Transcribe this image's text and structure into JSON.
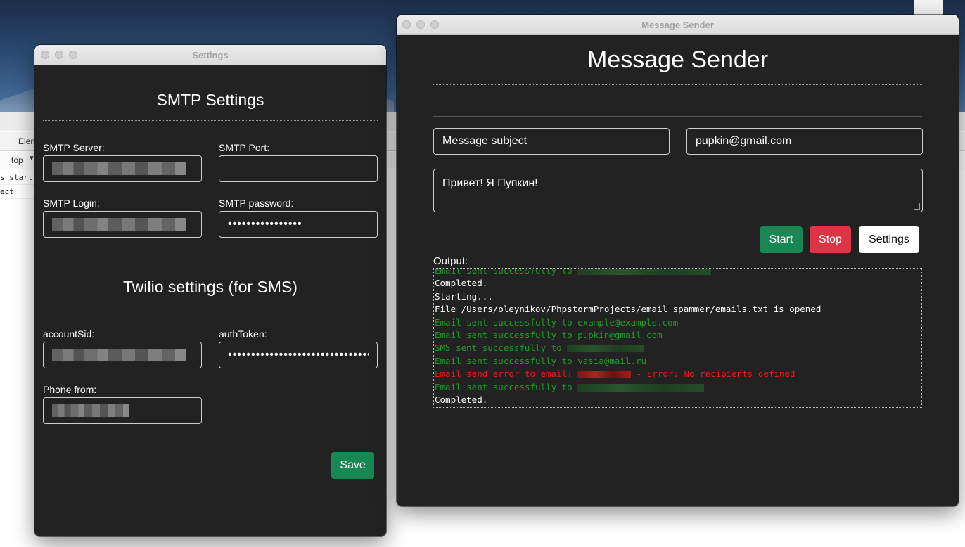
{
  "settings_window": {
    "title": "Settings",
    "smtp_heading": "SMTP Settings",
    "smtp_server_label": "SMTP Server:",
    "smtp_port_label": "SMTP Port:",
    "smtp_port_value": "",
    "smtp_login_label": "SMTP Login:",
    "smtp_password_label": "SMTP password:",
    "smtp_password_masked": "••••••••••••••••",
    "twilio_heading": "Twilio settings (for SMS)",
    "account_sid_label": "accountSid:",
    "auth_token_label": "authToken:",
    "auth_token_masked": "••••••••••••••••••••••••••••••••",
    "phone_from_label": "Phone from:",
    "save_label": "Save"
  },
  "sender_window": {
    "title": "Message Sender",
    "heading": "Message Sender",
    "subject_value": "Message subject",
    "email_value": "pupkin@gmail.com",
    "message_value": "Привет! Я Пупкин!",
    "start_label": "Start",
    "stop_label": "Stop",
    "settings_label": "Settings",
    "output_label": "Output:",
    "output_lines": [
      {
        "text": "Email sent successfully to ",
        "color": "green"
      },
      {
        "text": "Completed.",
        "color": "white"
      },
      {
        "text": "Starting...",
        "color": "white"
      },
      {
        "text": "File /Users/oleynikov/PhpstormProjects/email_spammer/emails.txt is opened",
        "color": "white"
      },
      {
        "text": "Email sent successfully to example@example.com",
        "color": "green"
      },
      {
        "text": "Email sent successfully to pupkin@gmail.com",
        "color": "green"
      },
      {
        "text": "SMS sent successfully to ",
        "color": "green"
      },
      {
        "text": "Email sent successfully to vasia@mail.ru",
        "color": "green"
      },
      {
        "text": "Email send error to email: ",
        "suffix": " - Error: No recipients defined",
        "color": "red"
      },
      {
        "text": "Email sent successfully to ",
        "color": "green"
      },
      {
        "text": "Completed.",
        "color": "white"
      }
    ]
  },
  "background": {
    "devtools_tab": "Elem",
    "context_selector": "top",
    "console_line_1": "s start",
    "console_line_2": "ect"
  },
  "colors": {
    "window_bg": "#222222",
    "success_green": "#198754",
    "danger_red": "#dc3545",
    "log_green": "#1f9a2a",
    "log_red": "#e81b1b"
  }
}
